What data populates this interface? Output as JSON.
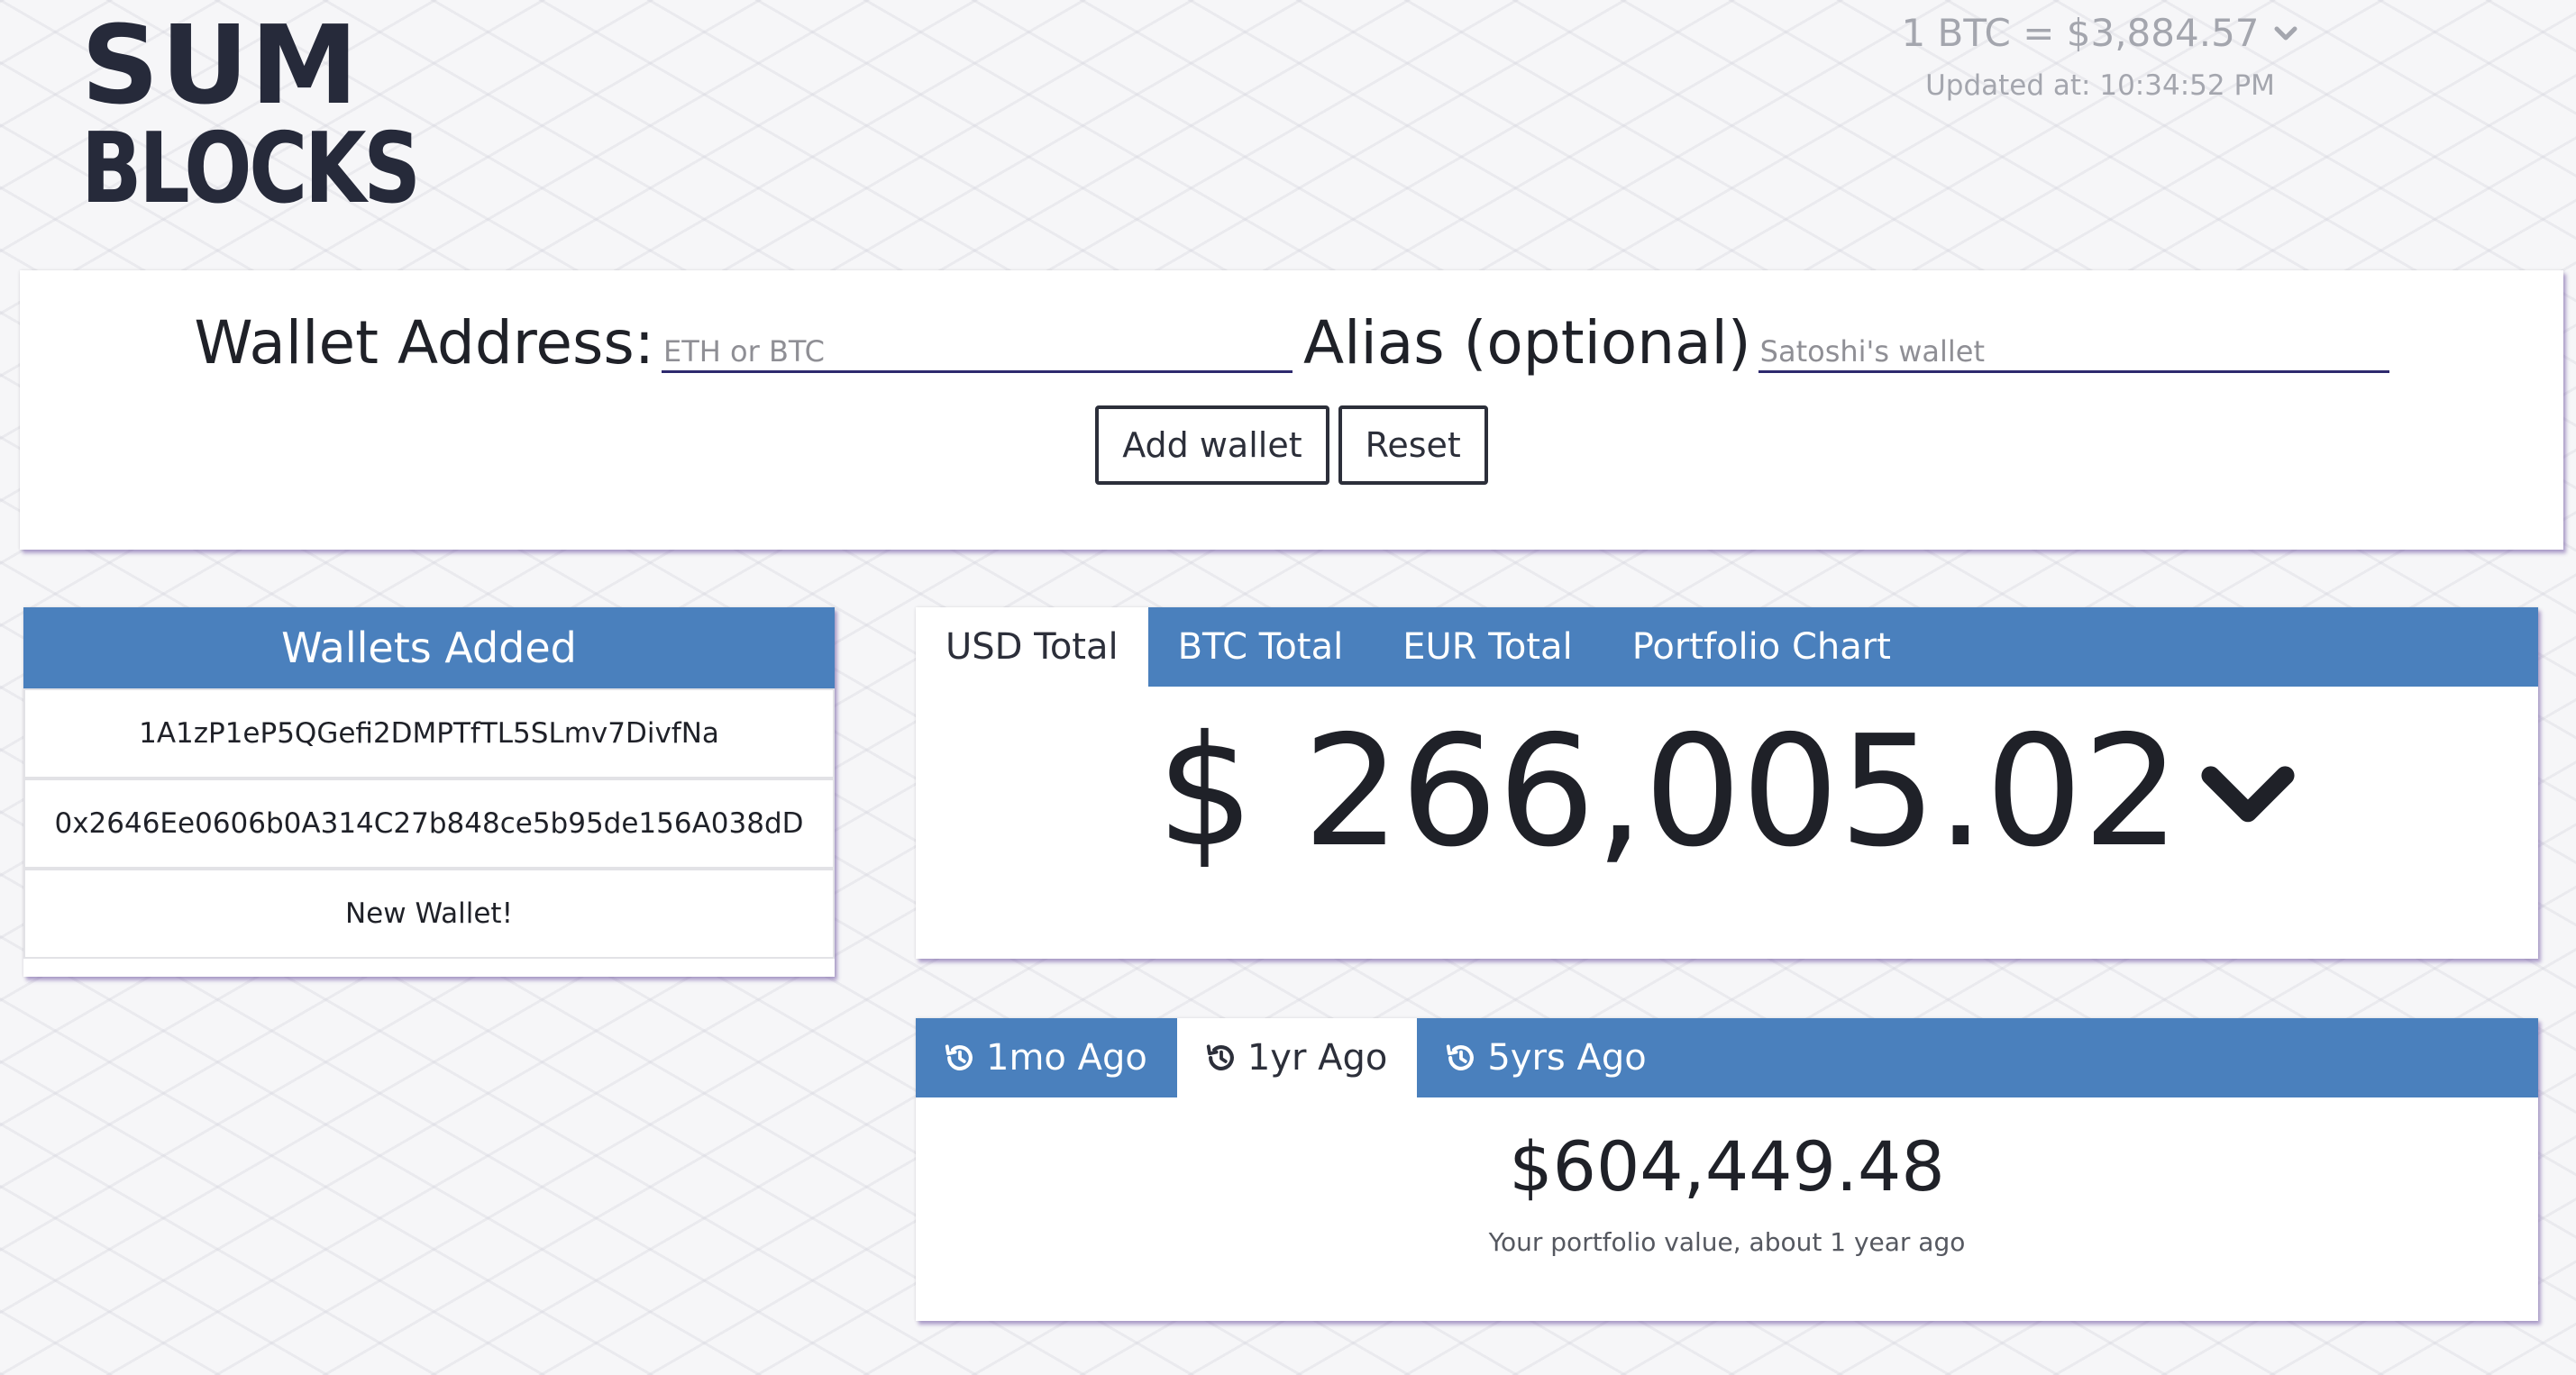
{
  "logo": {
    "line1": "SUM",
    "line2": "BLOCKS"
  },
  "rate": {
    "text": "1 BTC = $3,884.57",
    "updated": "Updated at: 10:34:52 PM"
  },
  "form": {
    "address_label": "Wallet Address:",
    "address_placeholder": "ETH or BTC",
    "address_value": "",
    "alias_label": "Alias (optional)",
    "alias_placeholder": "Satoshi's wallet",
    "alias_value": "",
    "add_button": "Add wallet",
    "reset_button": "Reset"
  },
  "wallets": {
    "title": "Wallets Added",
    "items": [
      {
        "label": "1A1zP1eP5QGefi2DMPTfTL5SLmv7DivfNa"
      },
      {
        "label": "0x2646Ee0606b0A314C27b848ce5b95de156A038dD"
      },
      {
        "label": "New Wallet!"
      }
    ]
  },
  "totals": {
    "tabs": [
      {
        "label": "USD Total",
        "active": true
      },
      {
        "label": "BTC Total",
        "active": false
      },
      {
        "label": "EUR Total",
        "active": false
      },
      {
        "label": "Portfolio Chart",
        "active": false
      }
    ],
    "value": "$ 266,005.02"
  },
  "history": {
    "tabs": [
      {
        "label": "1mo Ago",
        "active": false,
        "icon": "history-icon"
      },
      {
        "label": "1yr Ago",
        "active": true,
        "icon": "history-icon"
      },
      {
        "label": "5yrs Ago",
        "active": false,
        "icon": "history-icon"
      }
    ],
    "value": "$604,449.48",
    "caption": "Your portfolio value, about 1 year ago"
  },
  "colors": {
    "header_blue": "#4a80bd",
    "text_dark": "#1f2128",
    "muted_gray": "#a4a6ae",
    "input_underline": "#2e2a6e"
  }
}
